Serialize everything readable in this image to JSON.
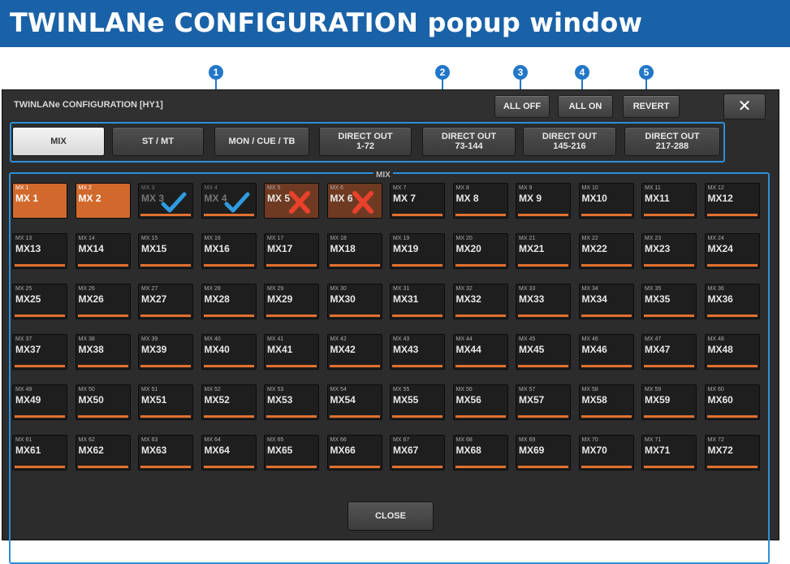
{
  "header": {
    "title": "TWINLANe CONFIGURATION popup window"
  },
  "callouts": [
    "1",
    "2",
    "3",
    "4",
    "5"
  ],
  "window": {
    "title": "TWINLANe CONFIGURATION [HY1]",
    "buttons": {
      "all_off": "ALL OFF",
      "all_on": "ALL ON",
      "revert": "REVERT",
      "close_x": "✕"
    },
    "tabs": [
      {
        "label": "MIX",
        "active": true
      },
      {
        "label": "ST / MT",
        "active": false
      },
      {
        "label": "MON / CUE / TB",
        "active": false
      },
      {
        "label": "DIRECT OUT\n1-72",
        "active": false
      },
      {
        "label": "DIRECT OUT\n73-144",
        "active": false
      },
      {
        "label": "DIRECT OUT\n145-216",
        "active": false
      },
      {
        "label": "DIRECT OUT\n217-288",
        "active": false
      }
    ],
    "grid_label": "MIX",
    "cells": [
      {
        "small": "MX 1",
        "big": "MX 1",
        "state": "on"
      },
      {
        "small": "MX 2",
        "big": "MX 2",
        "state": "on"
      },
      {
        "small": "MX 3",
        "big": "MX 3",
        "state": "check"
      },
      {
        "small": "MX 4",
        "big": "MX 4",
        "state": "check"
      },
      {
        "small": "MX 5",
        "big": "MX 5",
        "state": "cross"
      },
      {
        "small": "MX 6",
        "big": "MX 6",
        "state": "cross"
      },
      {
        "small": "MX 7",
        "big": "MX 7",
        "state": "off"
      },
      {
        "small": "MX 8",
        "big": "MX 8",
        "state": "off"
      },
      {
        "small": "MX 9",
        "big": "MX 9",
        "state": "off"
      },
      {
        "small": "MX 10",
        "big": "MX10",
        "state": "off"
      },
      {
        "small": "MX 11",
        "big": "MX11",
        "state": "off"
      },
      {
        "small": "MX 12",
        "big": "MX12",
        "state": "off"
      },
      {
        "small": "MX 13",
        "big": "MX13",
        "state": "off"
      },
      {
        "small": "MX 14",
        "big": "MX14",
        "state": "off"
      },
      {
        "small": "MX 15",
        "big": "MX15",
        "state": "off"
      },
      {
        "small": "MX 16",
        "big": "MX16",
        "state": "off"
      },
      {
        "small": "MX 17",
        "big": "MX17",
        "state": "off"
      },
      {
        "small": "MX 18",
        "big": "MX18",
        "state": "off"
      },
      {
        "small": "MX 19",
        "big": "MX19",
        "state": "off"
      },
      {
        "small": "MX 20",
        "big": "MX20",
        "state": "off"
      },
      {
        "small": "MX 21",
        "big": "MX21",
        "state": "off"
      },
      {
        "small": "MX 22",
        "big": "MX22",
        "state": "off"
      },
      {
        "small": "MX 23",
        "big": "MX23",
        "state": "off"
      },
      {
        "small": "MX 24",
        "big": "MX24",
        "state": "off"
      },
      {
        "small": "MX 25",
        "big": "MX25",
        "state": "off"
      },
      {
        "small": "MX 26",
        "big": "MX26",
        "state": "off"
      },
      {
        "small": "MX 27",
        "big": "MX27",
        "state": "off"
      },
      {
        "small": "MX 28",
        "big": "MX28",
        "state": "off"
      },
      {
        "small": "MX 29",
        "big": "MX29",
        "state": "off"
      },
      {
        "small": "MX 30",
        "big": "MX30",
        "state": "off"
      },
      {
        "small": "MX 31",
        "big": "MX31",
        "state": "off"
      },
      {
        "small": "MX 32",
        "big": "MX32",
        "state": "off"
      },
      {
        "small": "MX 33",
        "big": "MX33",
        "state": "off"
      },
      {
        "small": "MX 34",
        "big": "MX34",
        "state": "off"
      },
      {
        "small": "MX 35",
        "big": "MX35",
        "state": "off"
      },
      {
        "small": "MX 36",
        "big": "MX36",
        "state": "off"
      },
      {
        "small": "MX 37",
        "big": "MX37",
        "state": "off"
      },
      {
        "small": "MX 38",
        "big": "MX38",
        "state": "off"
      },
      {
        "small": "MX 39",
        "big": "MX39",
        "state": "off"
      },
      {
        "small": "MX 40",
        "big": "MX40",
        "state": "off"
      },
      {
        "small": "MX 41",
        "big": "MX41",
        "state": "off"
      },
      {
        "small": "MX 42",
        "big": "MX42",
        "state": "off"
      },
      {
        "small": "MX 43",
        "big": "MX43",
        "state": "off"
      },
      {
        "small": "MX 44",
        "big": "MX44",
        "state": "off"
      },
      {
        "small": "MX 45",
        "big": "MX45",
        "state": "off"
      },
      {
        "small": "MX 46",
        "big": "MX46",
        "state": "off"
      },
      {
        "small": "MX 47",
        "big": "MX47",
        "state": "off"
      },
      {
        "small": "MX 48",
        "big": "MX48",
        "state": "off"
      },
      {
        "small": "MX 49",
        "big": "MX49",
        "state": "off"
      },
      {
        "small": "MX 50",
        "big": "MX50",
        "state": "off"
      },
      {
        "small": "MX 51",
        "big": "MX51",
        "state": "off"
      },
      {
        "small": "MX 52",
        "big": "MX52",
        "state": "off"
      },
      {
        "small": "MX 53",
        "big": "MX53",
        "state": "off"
      },
      {
        "small": "MX 54",
        "big": "MX54",
        "state": "off"
      },
      {
        "small": "MX 55",
        "big": "MX55",
        "state": "off"
      },
      {
        "small": "MX 56",
        "big": "MX56",
        "state": "off"
      },
      {
        "small": "MX 57",
        "big": "MX57",
        "state": "off"
      },
      {
        "small": "MX 58",
        "big": "MX58",
        "state": "off"
      },
      {
        "small": "MX 59",
        "big": "MX59",
        "state": "off"
      },
      {
        "small": "MX 60",
        "big": "MX60",
        "state": "off"
      },
      {
        "small": "MX 61",
        "big": "MX61",
        "state": "off"
      },
      {
        "small": "MX 62",
        "big": "MX62",
        "state": "off"
      },
      {
        "small": "MX 63",
        "big": "MX63",
        "state": "off"
      },
      {
        "small": "MX 64",
        "big": "MX64",
        "state": "off"
      },
      {
        "small": "MX 65",
        "big": "MX65",
        "state": "off"
      },
      {
        "small": "MX 66",
        "big": "MX66",
        "state": "off"
      },
      {
        "small": "MX 67",
        "big": "MX67",
        "state": "off"
      },
      {
        "small": "MX 68",
        "big": "MX68",
        "state": "off"
      },
      {
        "small": "MX 69",
        "big": "MX69",
        "state": "off"
      },
      {
        "small": "MX 70",
        "big": "MX70",
        "state": "off"
      },
      {
        "small": "MX 71",
        "big": "MX71",
        "state": "off"
      },
      {
        "small": "MX 72",
        "big": "MX72",
        "state": "off"
      }
    ],
    "close_label": "CLOSE"
  },
  "colors": {
    "header": "#1a62a8",
    "accent": "#2d8fd8",
    "on": "#d2692c",
    "check": "#2f9be0",
    "cross": "#e8412c"
  }
}
